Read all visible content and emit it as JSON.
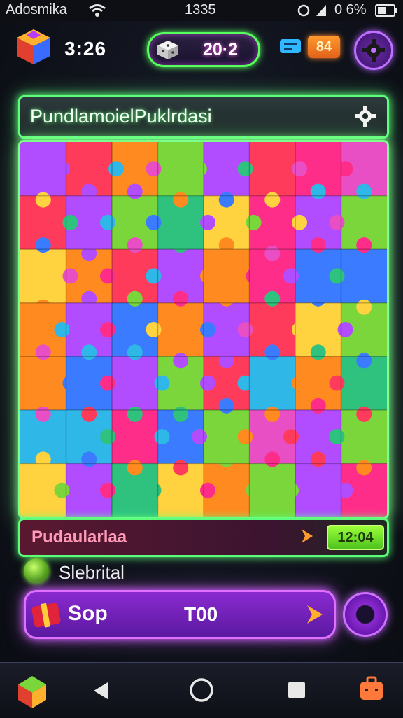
{
  "status_bar": {
    "carrier": "Adosmika",
    "time": "1335",
    "battery": "0 6%"
  },
  "hud": {
    "timer": "3:26",
    "score": "20·2",
    "chat_icon": "chat-bubble-icon",
    "badge_value": "84",
    "settings_icon": "gear-icon"
  },
  "puzzle": {
    "title": "PundlamoielPuklrdasi",
    "title_icon": "gear-icon"
  },
  "progress": {
    "label": "Pudaularlaa",
    "time": "12:04"
  },
  "powerup": {
    "label": "Slebrital"
  },
  "action": {
    "label": "Sop",
    "value": "T00"
  },
  "nav": {
    "back_icon": "back-triangle-icon",
    "home_icon": "home-circle-icon",
    "recent_icon": "recent-square-icon"
  },
  "colors": {
    "neon_green": "#5cff7a",
    "neon_purple": "#d060ff",
    "piece_palette": [
      "#ff2d8a",
      "#ff8a1f",
      "#7ad63a",
      "#2fb7e8",
      "#b14cff",
      "#ff3b5c",
      "#ffd23f",
      "#2ec27e",
      "#e84fc4",
      "#3a7bff"
    ]
  }
}
